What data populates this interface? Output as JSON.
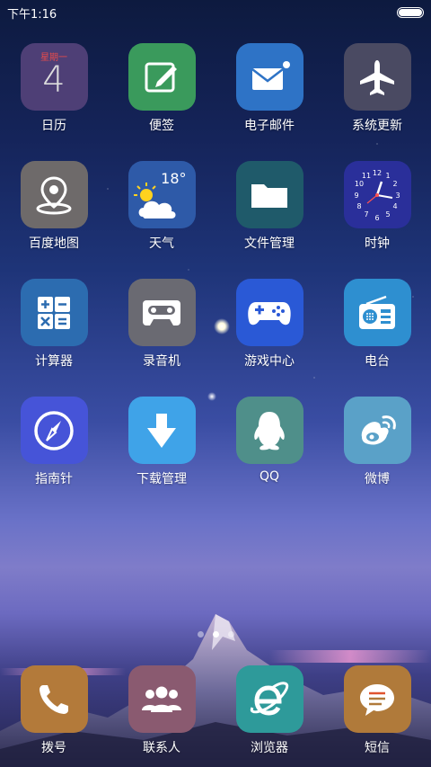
{
  "status": {
    "time": "下午1:16"
  },
  "apps": [
    {
      "label": "日历",
      "bg": "#4e3f76",
      "icon": "calendar-icon",
      "cal_week": "星期一",
      "cal_day": "4"
    },
    {
      "label": "便签",
      "bg": "#3a9a5c",
      "icon": "note-edit-icon"
    },
    {
      "label": "电子邮件",
      "bg": "#2e73c6",
      "icon": "mail-icon"
    },
    {
      "label": "系统更新",
      "bg": "#4a4a62",
      "icon": "airplane-icon"
    },
    {
      "label": "百度地图",
      "bg": "#6e6a6a",
      "icon": "map-pin-icon"
    },
    {
      "label": "天气",
      "bg": "#2e5aa8",
      "icon": "weather-icon",
      "temp": "18°"
    },
    {
      "label": "文件管理",
      "bg": "#1f5a6a",
      "icon": "folder-icon"
    },
    {
      "label": "时钟",
      "bg": "#2a2f9a",
      "icon": "clock-icon"
    },
    {
      "label": "计算器",
      "bg": "#2c6cb0",
      "icon": "calculator-icon"
    },
    {
      "label": "录音机",
      "bg": "#6a6a72",
      "icon": "cassette-icon"
    },
    {
      "label": "游戏中心",
      "bg": "#2a59d6",
      "icon": "gamepad-icon"
    },
    {
      "label": "电台",
      "bg": "#2e8fd0",
      "icon": "radio-icon"
    },
    {
      "label": "指南针",
      "bg": "#4654d8",
      "icon": "compass-icon"
    },
    {
      "label": "下载管理",
      "bg": "#3fa3e8",
      "icon": "download-arrow-icon"
    },
    {
      "label": "QQ",
      "bg": "#4f8f8a",
      "icon": "qq-penguin-icon"
    },
    {
      "label": "微博",
      "bg": "#5aa1c8",
      "icon": "weibo-icon"
    }
  ],
  "dock": [
    {
      "label": "拨号",
      "bg": "#b37a3a",
      "icon": "phone-icon"
    },
    {
      "label": "联系人",
      "bg": "#8a5a70",
      "icon": "contacts-icon"
    },
    {
      "label": "浏览器",
      "bg": "#2e9a9a",
      "icon": "browser-e-icon"
    },
    {
      "label": "短信",
      "bg": "#b07a3a",
      "icon": "message-icon"
    }
  ],
  "pages": {
    "count": 3,
    "active": 1
  }
}
